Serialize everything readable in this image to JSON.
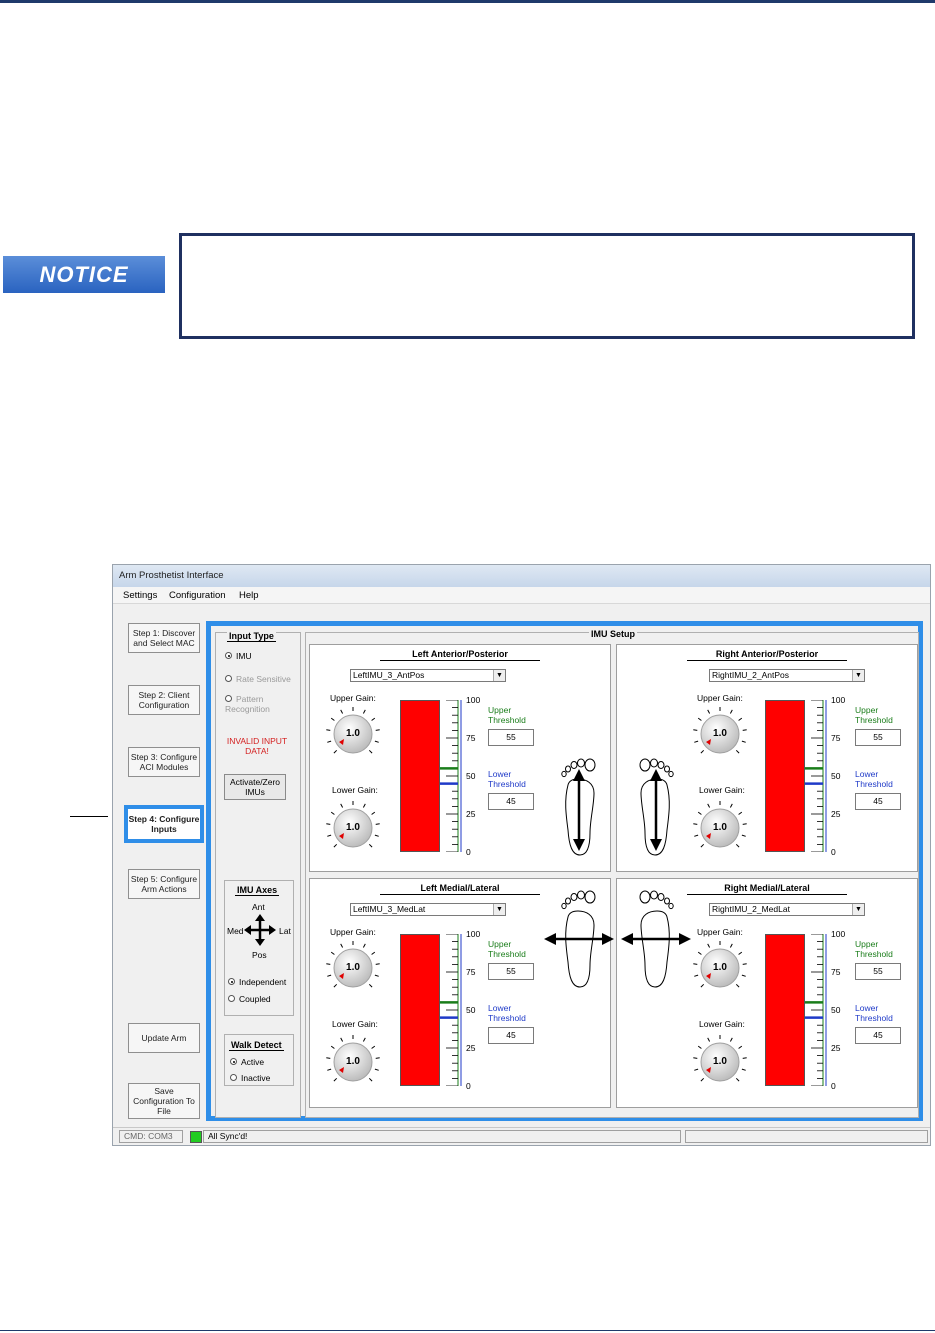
{
  "notice": {
    "label": "NOTICE"
  },
  "window": {
    "title": "Arm Prosthetist Interface"
  },
  "menu": [
    "Settings",
    "Configuration",
    "Help"
  ],
  "steps": [
    {
      "label": "Step 1: Discover and Select MAC"
    },
    {
      "label": "Step 2: Client Configuration"
    },
    {
      "label": "Step 3: Configure ACI Modules"
    },
    {
      "label": "Step 4: Configure Inputs",
      "active": true
    },
    {
      "label": "Step 5: Configure Arm Actions"
    },
    {
      "label": "Update Arm"
    },
    {
      "label": "Save Configuration To File"
    }
  ],
  "input_type": {
    "title": "Input Type",
    "options": [
      "IMU",
      "Rate Sensitive",
      "Pattern Recognition"
    ],
    "selected": "IMU",
    "error": "INVALID INPUT DATA!",
    "activate_label": "Activate/Zero IMUs"
  },
  "imu_axes": {
    "title": "IMU Axes",
    "ant": "Ant",
    "pos": "Pos",
    "med": "Med",
    "lat": "Lat",
    "options": [
      "Independent",
      "Coupled"
    ],
    "selected": "Independent"
  },
  "walk_detect": {
    "title": "Walk Detect",
    "options": [
      "Active",
      "Inactive"
    ],
    "selected": "Active"
  },
  "imu_setup": {
    "title": "IMU Setup",
    "upper_gain_label": "Upper Gain:",
    "lower_gain_label": "Lower Gain:",
    "upper_threshold_label": "Upper Threshold",
    "lower_threshold_label": "Lower Threshold",
    "scale_labels": [
      "100",
      "75",
      "50",
      "25",
      "0"
    ],
    "colors": {
      "bar": "#ff0000",
      "upper": "#1a7d1a",
      "lower": "#1f3ac8",
      "accent": "#2f8ee8"
    },
    "panels": [
      {
        "title": "Left Anterior/Posterior",
        "input": "LeftIMU_3_AntPos",
        "upper_gain": "1.0",
        "lower_gain": "1.0",
        "upper_threshold": "55",
        "lower_threshold": "45",
        "level": 100,
        "foot": "left",
        "motion": "ant-pos"
      },
      {
        "title": "Right Anterior/Posterior",
        "input": "RightIMU_2_AntPos",
        "upper_gain": "1.0",
        "lower_gain": "1.0",
        "upper_threshold": "55",
        "lower_threshold": "45",
        "level": 100,
        "foot": "right",
        "motion": "ant-pos"
      },
      {
        "title": "Left Medial/Lateral",
        "input": "LeftIMU_3_MedLat",
        "upper_gain": "1.0",
        "lower_gain": "1.0",
        "upper_threshold": "55",
        "lower_threshold": "45",
        "level": 100,
        "foot": "left",
        "motion": "med-lat"
      },
      {
        "title": "Right Medial/Lateral",
        "input": "RightIMU_2_MedLat",
        "upper_gain": "1.0",
        "lower_gain": "1.0",
        "upper_threshold": "55",
        "lower_threshold": "45",
        "level": 100,
        "foot": "right",
        "motion": "med-lat"
      }
    ]
  },
  "status": {
    "port": "CMD: COM3",
    "sync": "All Sync'd!",
    "indicator_color": "#22cc22"
  }
}
